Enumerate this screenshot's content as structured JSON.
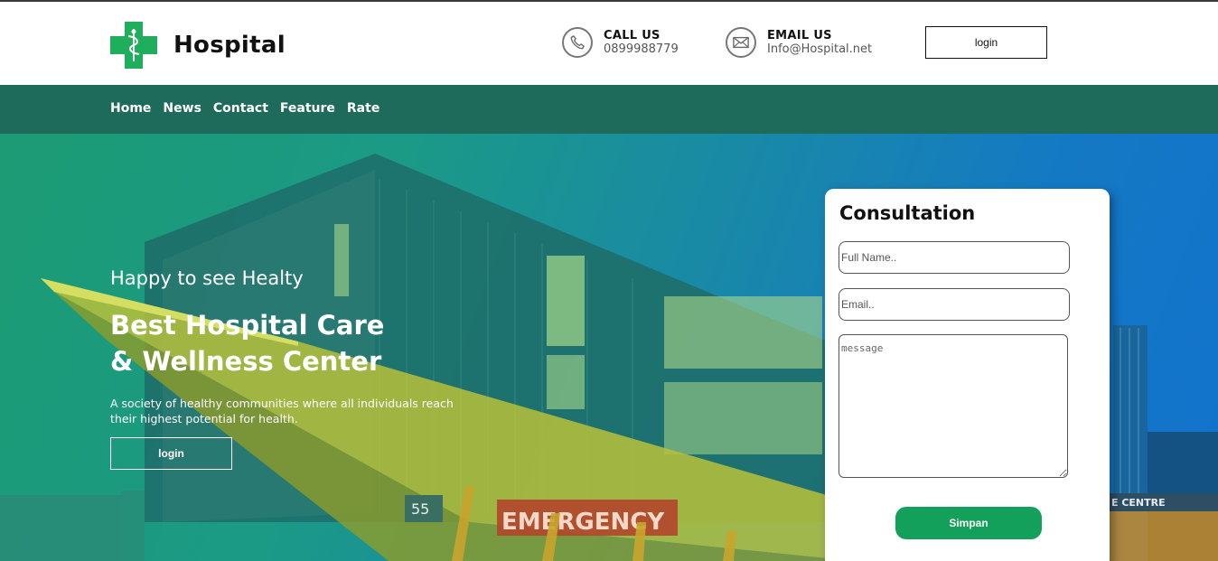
{
  "brand": {
    "name": "Hospital",
    "accent": "#1fae5b",
    "nav_bg": "#1f6b5b"
  },
  "header": {
    "call": {
      "label": "CALL US",
      "value": "0899988779",
      "icon": "phone-icon"
    },
    "email": {
      "label": "EMAIL US",
      "value": "Info@Hospital.net",
      "icon": "mail-icon"
    },
    "login_label": "login"
  },
  "nav": {
    "items": [
      "Home",
      "News",
      "Contact",
      "Feature",
      "Rate"
    ]
  },
  "hero": {
    "subtitle": "Happy to see Healty",
    "title_line1": "Best Hospital Care",
    "title_line2": "& Wellness Center",
    "description": "A society of healthy communities where all individuals reach their highest potential for health.",
    "login_label": "login",
    "sign_number": "55",
    "sign_emergency": "EMERGENCY",
    "sign_centre": "E CENTRE"
  },
  "consultation": {
    "title": "Consultation",
    "name_placeholder": "Full Name..",
    "email_placeholder": "Email..",
    "message_placeholder": "message",
    "submit_label": "Simpan",
    "submit_color": "#12a05a"
  }
}
